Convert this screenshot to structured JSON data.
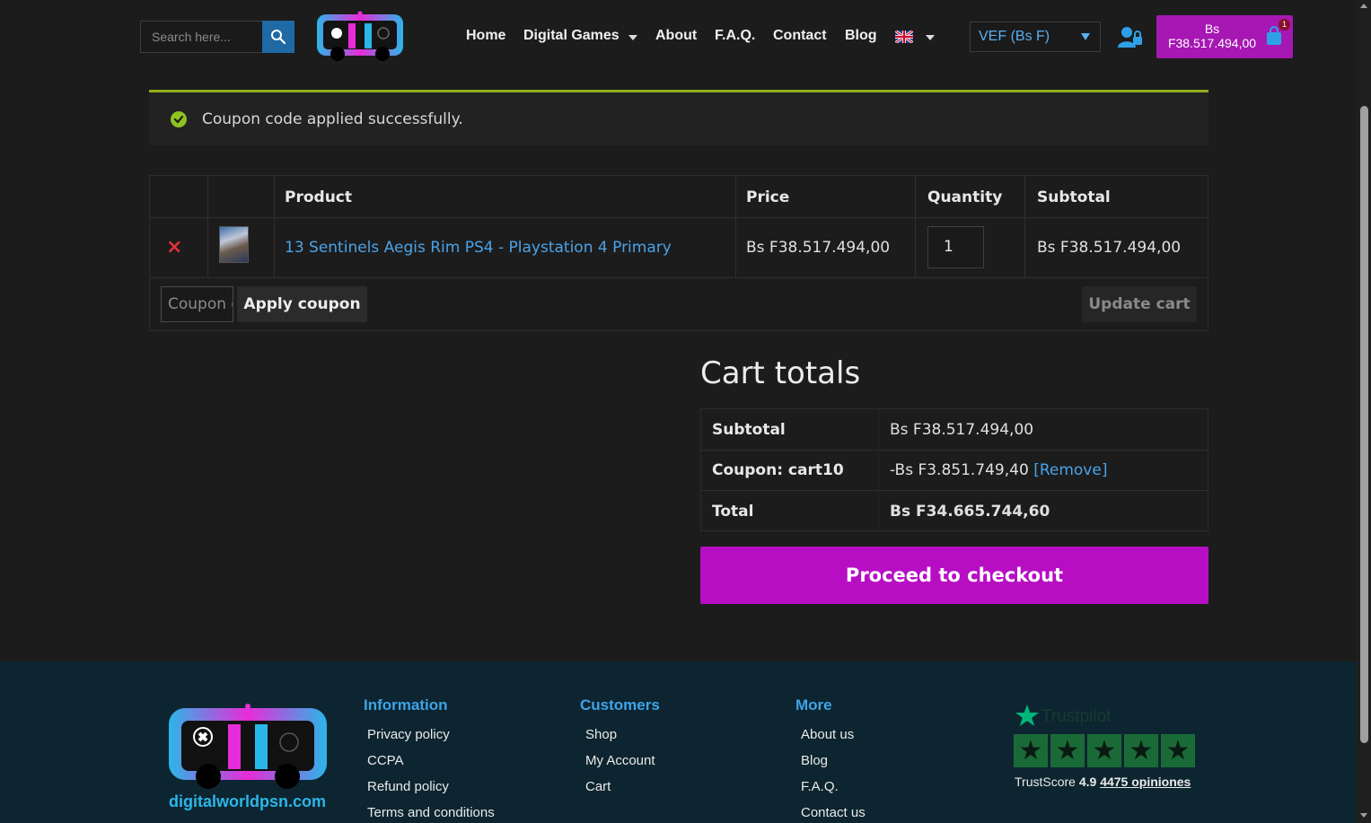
{
  "header": {
    "search_placeholder": "Search here...",
    "nav": {
      "home": "Home",
      "digital_games": "Digital Games",
      "about": "About",
      "faq": "F.A.Q.",
      "contact": "Contact",
      "blog": "Blog"
    },
    "currency": "VEF (Bs F)",
    "cart_line1": "Bs",
    "cart_line2": "F38.517.494,00",
    "cart_count": "1"
  },
  "notice": {
    "message": "Coupon code applied successfully."
  },
  "cart_table": {
    "headers": {
      "product": "Product",
      "price": "Price",
      "quantity": "Quantity",
      "subtotal": "Subtotal"
    },
    "item": {
      "remove": "×",
      "name": "13 Sentinels Aegis Rim PS4 - Playstation 4 Primary",
      "price": "Bs F38.517.494,00",
      "quantity": "1",
      "subtotal": "Bs F38.517.494,00"
    },
    "coupon_placeholder": "Coupon code",
    "apply_label": "Apply coupon",
    "update_label": "Update cart"
  },
  "totals": {
    "title": "Cart totals",
    "subtotal_label": "Subtotal",
    "subtotal_value": "Bs F38.517.494,00",
    "coupon_label": "Coupon: cart10",
    "coupon_value": "-Bs F3.851.749,40",
    "coupon_remove": "[Remove]",
    "total_label": "Total",
    "total_value": "Bs F34.665.744,60",
    "checkout_label": "Proceed to checkout"
  },
  "footer": {
    "domain": "digitalworldpsn.com",
    "information": {
      "title": "Information",
      "links": [
        "Privacy policy",
        "CCPA",
        "Refund policy",
        "Terms and conditions"
      ]
    },
    "customers": {
      "title": "Customers",
      "links": [
        "Shop",
        "My Account",
        "Cart"
      ]
    },
    "more": {
      "title": "More",
      "links": [
        "About us",
        "Blog",
        "F.A.Q.",
        "Contact us"
      ]
    },
    "trustpilot": {
      "brand": "Trustpilot",
      "score_label": "TrustScore",
      "score": "4.9",
      "reviews": "4475 opiniones"
    }
  },
  "colors": {
    "accent": "#b70ec4",
    "link": "#4aa3e8",
    "success": "#8fc31f",
    "footer_bg": "#0d2530"
  }
}
